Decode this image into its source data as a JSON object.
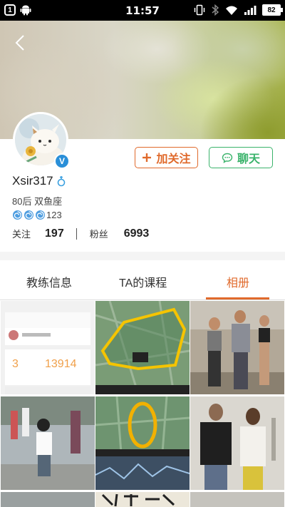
{
  "status_bar": {
    "notification_count": "1",
    "time": "11:57",
    "battery": "82"
  },
  "profile": {
    "follow_button": "加关注",
    "chat_button": "聊天",
    "username": "Xsir317",
    "tags": "80后  双鱼座",
    "level": "123",
    "following_label": "关注",
    "following_count": "197",
    "fans_label": "粉丝",
    "fans_count": "6993",
    "verified_badge": "V"
  },
  "tabs": [
    {
      "label": "教练信息",
      "active": false
    },
    {
      "label": "TA的课程",
      "active": false
    },
    {
      "label": "相册",
      "active": true
    }
  ],
  "album": {
    "photos": [
      {
        "name": "app-screenshot"
      },
      {
        "name": "running-route-map"
      },
      {
        "name": "fitness-group-photo"
      },
      {
        "name": "child-square-dance"
      },
      {
        "name": "running-loop-map"
      },
      {
        "name": "gym-trainers-photo"
      },
      {
        "name": "street-photo"
      },
      {
        "name": "calligraphy-photo"
      },
      {
        "name": "partial-photo"
      }
    ],
    "screenshot_values": [
      "3",
      "13914"
    ]
  },
  "colors": {
    "accent_orange": "#e06a2c",
    "accent_green": "#3ab36b",
    "verified_blue": "#2a8fd8"
  }
}
